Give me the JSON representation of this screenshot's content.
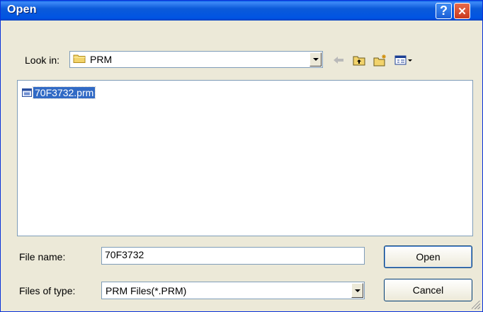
{
  "window": {
    "title": "Open"
  },
  "look_in": {
    "label": "Look in:",
    "value": "PRM"
  },
  "files": [
    {
      "name": "70F3732.prm"
    }
  ],
  "file_name": {
    "label": "File name:",
    "value": "70F3732"
  },
  "file_type": {
    "label": "Files of type:",
    "value": "PRM Files(*.PRM)"
  },
  "buttons": {
    "open": "Open",
    "cancel": "Cancel"
  },
  "title_buttons": {
    "help": "?",
    "close": "✕"
  },
  "colors": {
    "titlebar": "#0054e3",
    "selection": "#316ac5",
    "face": "#ece9d8"
  },
  "icons": [
    "folder-icon",
    "back-arrow-icon",
    "up-folder-icon",
    "new-folder-icon",
    "view-menu-icon",
    "file-icon"
  ]
}
